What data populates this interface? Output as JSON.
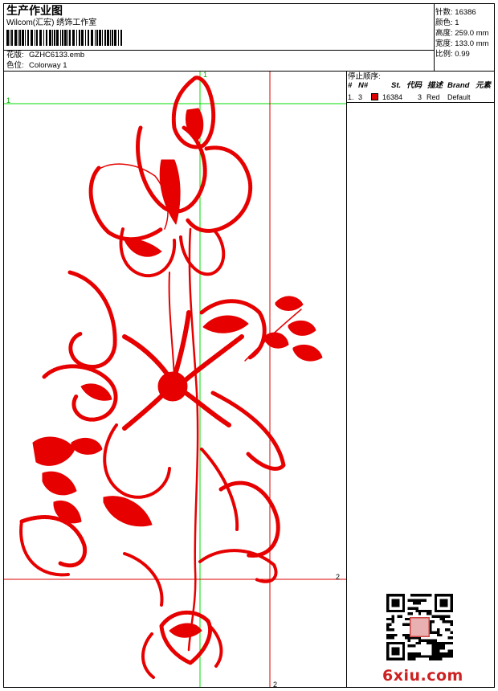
{
  "header": {
    "title": "生产作业图",
    "company": "Wilcom(汇宏) 绣饰工作室",
    "design_label": "花版:",
    "design_value": "GZHC6133.emb",
    "colorway_label": "色位:",
    "colorway_value": "Colorway 1"
  },
  "stats": {
    "stitches_label": "针数:",
    "stitches_value": "16386",
    "colors_label": "颜色:",
    "colors_value": "1",
    "height_label": "高度:",
    "height_value": "259.0 mm",
    "width_label": "宽度:",
    "width_value": "133.0 mm",
    "scale_label": "比例:",
    "scale_value": "0.99"
  },
  "stop_sequence": {
    "title": "停止顺序:",
    "columns": [
      "#",
      "N#",
      "St.",
      "代码",
      "描述",
      "Brand",
      "元素"
    ],
    "rows": [
      {
        "index": "1.",
        "needle": "3",
        "stitches": "16384",
        "code": "3",
        "description": "Red",
        "brand": "Default",
        "color": "#dd0000"
      }
    ]
  },
  "markers": {
    "green_v": "1",
    "green_h": "1",
    "red_v": "2",
    "red_h": "2"
  },
  "watermark": "6xiu.com",
  "colors": {
    "thread": "#e60000",
    "guide_green": "#00dd00",
    "guide_red": "#dd0000"
  }
}
